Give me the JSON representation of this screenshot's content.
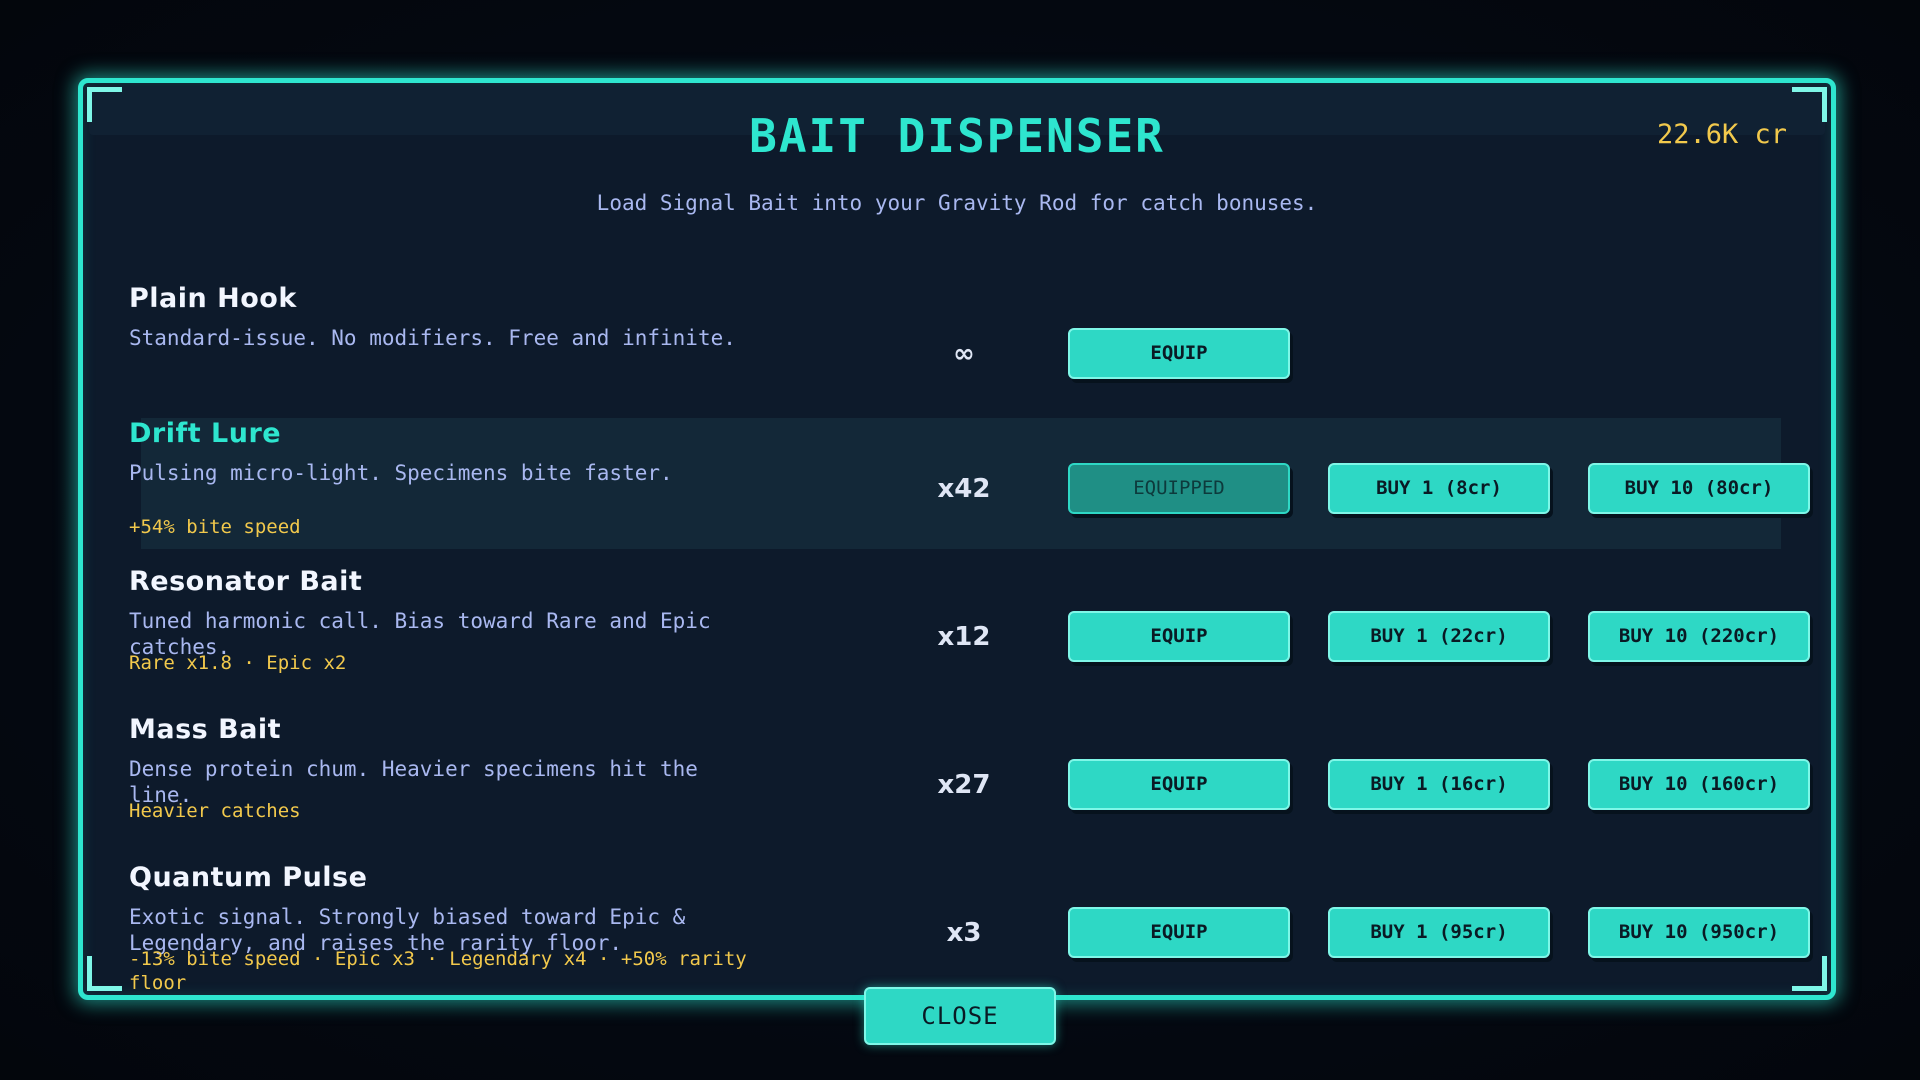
{
  "header": {
    "title": "BAIT DISPENSER",
    "credits": "22.6K cr",
    "subtitle": "Load Signal Bait into your Gravity Rod for catch bonuses."
  },
  "colors": {
    "accent": "#2ee6cf",
    "credits": "#f2c94c",
    "bonus": "#f2c94c",
    "description": "#a9b8f0",
    "panel": "#0d1a2b"
  },
  "baits": [
    {
      "name": "Plain Hook",
      "description": "Standard-issue. No modifiers. Free and infinite.",
      "bonus": "",
      "count": "∞",
      "equip_label": "EQUIP",
      "equipped": false
    },
    {
      "name": "Drift Lure",
      "description": "Pulsing micro-light. Specimens bite faster.",
      "bonus": "+54% bite speed",
      "count": "x42",
      "equip_label": "EQUIPPED",
      "equipped": true,
      "buy1_label": "BUY 1 (8cr)",
      "buy10_label": "BUY 10 (80cr)"
    },
    {
      "name": "Resonator Bait",
      "description": "Tuned harmonic call. Bias toward Rare and Epic catches.",
      "bonus": "Rare x1.8 · Epic x2",
      "count": "x12",
      "equip_label": "EQUIP",
      "equipped": false,
      "buy1_label": "BUY 1 (22cr)",
      "buy10_label": "BUY 10 (220cr)"
    },
    {
      "name": "Mass Bait",
      "description": "Dense protein chum. Heavier specimens hit the line.",
      "bonus": "Heavier catches",
      "count": "x27",
      "equip_label": "EQUIP",
      "equipped": false,
      "buy1_label": "BUY 1 (16cr)",
      "buy10_label": "BUY 10 (160cr)"
    },
    {
      "name": "Quantum Pulse",
      "description": "Exotic signal. Strongly biased toward Epic & Legendary, and raises the rarity floor.",
      "bonus": "-13% bite speed · Epic x3 · Legendary x4 · +50% rarity floor",
      "count": "x3",
      "equip_label": "EQUIP",
      "equipped": false,
      "buy1_label": "BUY 1 (95cr)",
      "buy10_label": "BUY 10 (950cr)"
    }
  ],
  "footer": {
    "close_label": "CLOSE"
  }
}
